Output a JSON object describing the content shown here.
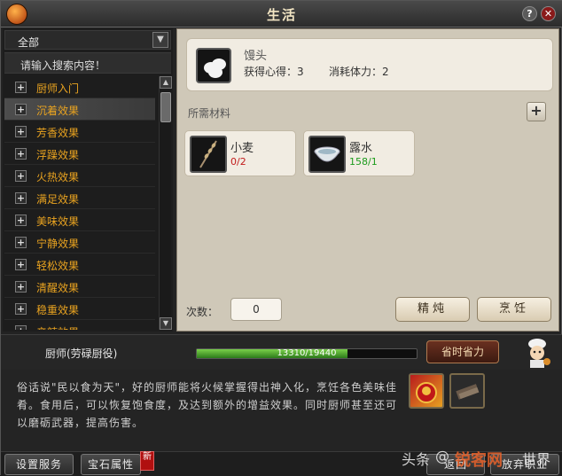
{
  "window": {
    "title": "生活",
    "help_label": "?",
    "close_label": "✕"
  },
  "sidebar": {
    "category": "全部",
    "search_placeholder": "请输入搜索内容！",
    "items": [
      {
        "label": "厨师入门"
      },
      {
        "label": "沉着效果"
      },
      {
        "label": "芳香效果"
      },
      {
        "label": "浮躁效果"
      },
      {
        "label": "火热效果"
      },
      {
        "label": "满足效果"
      },
      {
        "label": "美味效果"
      },
      {
        "label": "宁静效果"
      },
      {
        "label": "轻松效果"
      },
      {
        "label": "清醒效果"
      },
      {
        "label": "稳重效果"
      },
      {
        "label": "辛辣效果"
      }
    ],
    "selected_index": 1
  },
  "recipe": {
    "name": "馒头",
    "gain_text": "获得心得：3",
    "cost_text": "消耗体力：2",
    "materials_title": "所需材料",
    "add_label": "+",
    "materials": [
      {
        "name": "小麦",
        "count": "0/2",
        "icon": "wheat-stalk"
      },
      {
        "name": "露水",
        "count": "158/1",
        "icon": "dew-bowl"
      }
    ],
    "times_label": "次数：",
    "times_value": "0",
    "simmer_label": "精炖",
    "cook_label": "烹饪"
  },
  "profession": {
    "name": "厨师(劳碌厨役)",
    "progress_text": "13310/19440",
    "progress_fraction": 0.685,
    "saver_label": "省时省力",
    "description": "俗话说\"民以食为天\"，好的厨师能将火候掌握得出神入化，烹饪各色美味佳肴。食用后，可以恢复饱食度，及达到额外的增益效果。同时厨师甚至还可以磨砺武器，提高伤害。"
  },
  "footer": {
    "settings_label": "设置服务",
    "gem_label": "宝石属性",
    "new_badge": "新",
    "back_label": "返回",
    "abandon_label": "放弃职业"
  },
  "watermark": {
    "source": "头条",
    "handle": "@",
    "site": "锐客网",
    "suffix": "世界"
  },
  "colors": {
    "list_text": "#e9a320",
    "panel_bg": "#cfc8b8",
    "count_insufficient": "#c21a1a",
    "count_sufficient": "#1c9b1c",
    "progress_green": "#5fb83a"
  }
}
